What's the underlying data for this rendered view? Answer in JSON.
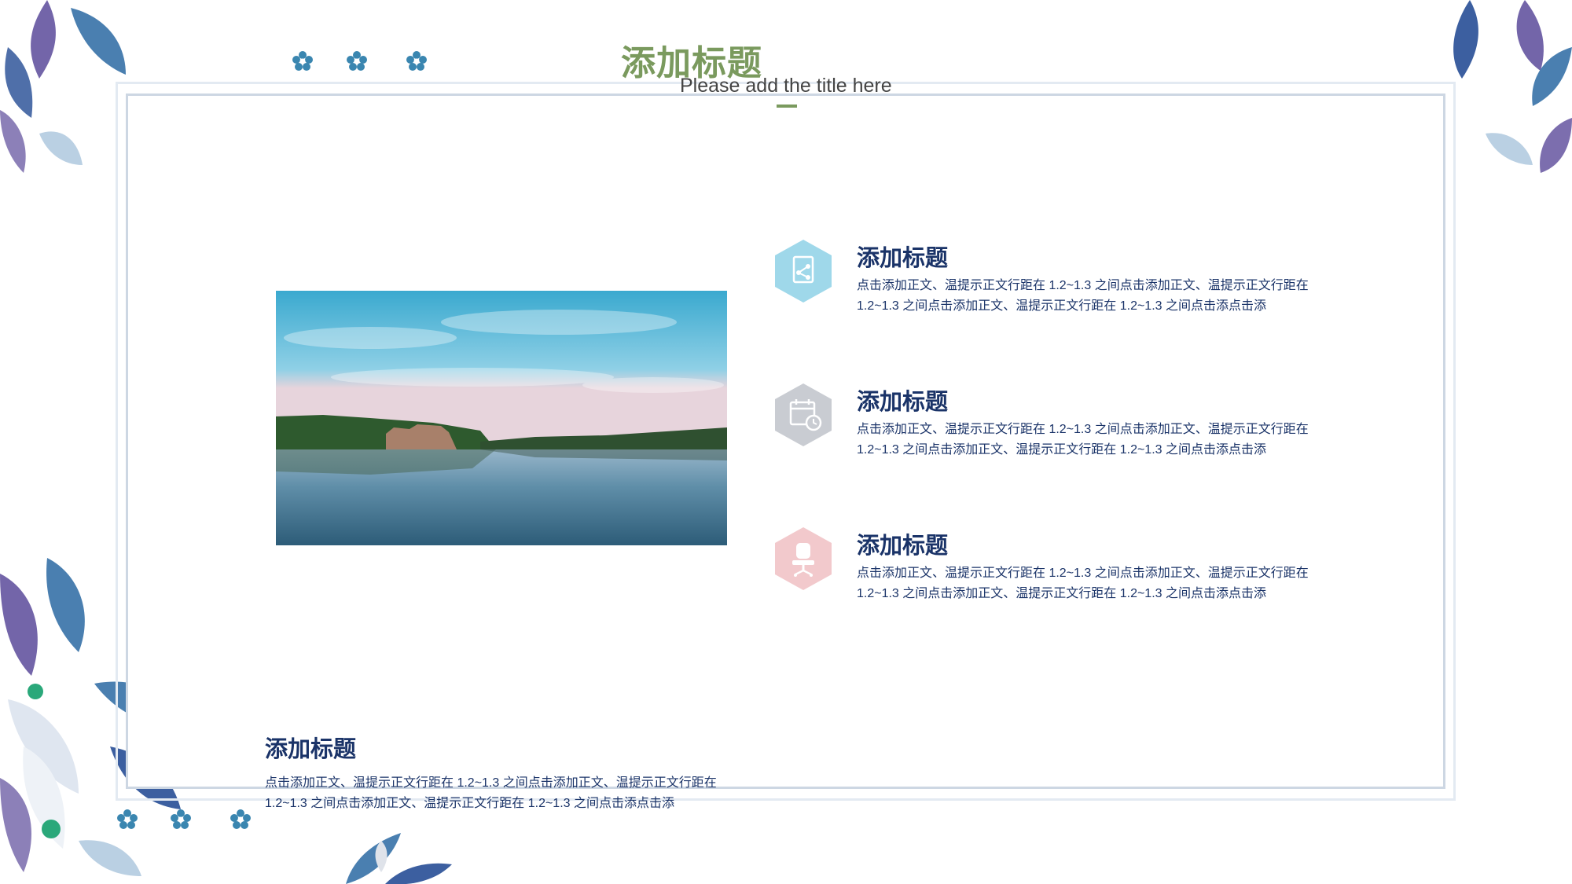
{
  "header": {
    "title_cn": "添加标题",
    "title_en": "Please add the title here"
  },
  "photo": {
    "icon": "lake-landscape-image"
  },
  "items": [
    {
      "icon": "document-share-icon",
      "color": "#9fd8ea",
      "title": "添加标题",
      "body": "点击添加正文、温提示正文行距在 1.2~1.3 之间点击添加正文、温提示正文行距在 1.2~1.3 之间点击添加正文、温提示正文行距在 1.2~1.3 之间点击添点击添"
    },
    {
      "icon": "calendar-clock-icon",
      "color": "#c9ccd2",
      "title": "添加标题",
      "body": "点击添加正文、温提示正文行距在 1.2~1.3 之间点击添加正文、温提示正文行距在 1.2~1.3 之间点击添加正文、温提示正文行距在 1.2~1.3 之间点击添点击添"
    },
    {
      "icon": "office-chair-icon",
      "color": "#f2c9cc",
      "title": "添加标题",
      "body": "点击添加正文、温提示正文行距在 1.2~1.3 之间点击添加正文、温提示正文行距在 1.2~1.3 之间点击添加正文、温提示正文行距在 1.2~1.3 之间点击添点击添"
    }
  ],
  "bottom": {
    "title": "添加标题",
    "body": "点击添加正文、温提示正文行距在 1.2~1.3 之间点击添加正文、温提示正文行距在 1.2~1.3 之间点击添加正文、温提示正文行距在 1.2~1.3 之间点击添点击添"
  },
  "colors": {
    "accent_green": "#7a9a5e",
    "text_navy": "#1a3368",
    "leaf_blue": "#4a6fa8",
    "leaf_purple": "#5b4a9a",
    "flower_teal": "#3a86b0"
  }
}
